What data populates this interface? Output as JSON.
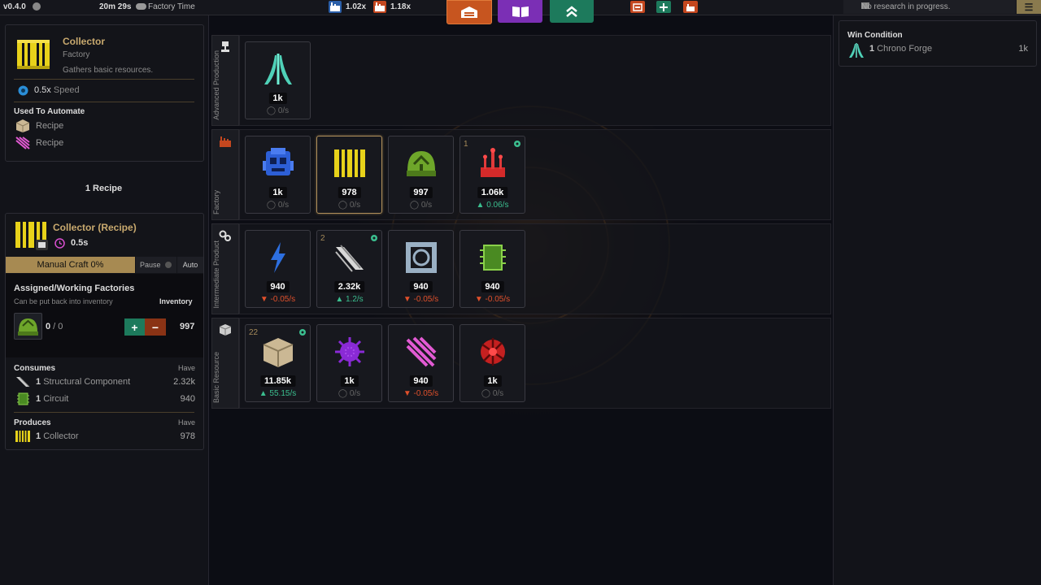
{
  "topbar": {
    "version": "v0.4.0",
    "elapsed": "20m 29s",
    "time_mode": "Factory Time",
    "multiplier_a": "1.02x",
    "multiplier_b": "1.18x",
    "research_status": "No research in progress.",
    "menu_glyph": "☰"
  },
  "selected": {
    "name": "Collector",
    "type": "Factory",
    "description": "Gathers basic resources.",
    "speed_value": "0.5x",
    "speed_label": "Speed",
    "used_to_automate_label": "Used To Automate",
    "automate": [
      "Recipe",
      "Recipe"
    ]
  },
  "recipes_count": "1 Recipe",
  "recipe": {
    "title": "Collector (Recipe)",
    "time": "0.5s",
    "manual_craft": "Manual Craft 0%",
    "pause_label": "Pause",
    "auto_label": "Auto",
    "assigned_title": "Assigned/Working Factories",
    "assigned_hint": "Can be put back into inventory",
    "inventory_label": "Inventory",
    "working": "0",
    "assigned_total": "0",
    "inventory_value": "997",
    "plus": "+",
    "minus": "−",
    "consumes_label": "Consumes",
    "have_label": "Have",
    "consumes": [
      {
        "qty": "1",
        "name": "Structural Component",
        "have": "2.32k"
      },
      {
        "qty": "1",
        "name": "Circuit",
        "have": "940"
      }
    ],
    "produces_label": "Produces",
    "produces": [
      {
        "qty": "1",
        "name": "Collector",
        "have": "978"
      }
    ]
  },
  "categories": [
    {
      "label": "Advanced Production"
    },
    {
      "label": "Factory"
    },
    {
      "label": "Intermediate Product"
    },
    {
      "label": "Basic Resource"
    }
  ],
  "items": {
    "advanced": [
      {
        "icon": "chrono-forge-icon",
        "count": "1k",
        "rate": "◯ 0/s",
        "badge": ""
      }
    ],
    "factory": [
      {
        "icon": "robot-factory-icon",
        "count": "1k",
        "rate": "◯ 0/s",
        "badge": ""
      },
      {
        "icon": "collector-icon",
        "count": "978",
        "rate": "◯ 0/s",
        "badge": ""
      },
      {
        "icon": "green-dome-icon",
        "count": "997",
        "rate": "◯ 0/s",
        "badge": ""
      },
      {
        "icon": "red-tower-icon",
        "count": "1.06k",
        "rate": "▲ 0.06/s",
        "badge": "1"
      }
    ],
    "intermediate": [
      {
        "icon": "lightning-icon",
        "count": "940",
        "rate": "▼ -0.05/s",
        "badge": ""
      },
      {
        "icon": "beam-icon",
        "count": "2.32k",
        "rate": "▲ 1.2/s",
        "badge": "2"
      },
      {
        "icon": "frame-icon",
        "count": "940",
        "rate": "▼ -0.05/s",
        "badge": ""
      },
      {
        "icon": "circuit-icon",
        "count": "940",
        "rate": "▼ -0.05/s",
        "badge": ""
      }
    ],
    "basic": [
      {
        "icon": "crate-icon",
        "count": "11.85k",
        "rate": "▲ 55.15/s",
        "badge": "22"
      },
      {
        "icon": "purple-flower-icon",
        "count": "1k",
        "rate": "◯ 0/s",
        "badge": ""
      },
      {
        "icon": "pink-crystal-icon",
        "count": "940",
        "rate": "▼ -0.05/s",
        "badge": ""
      },
      {
        "icon": "red-orb-icon",
        "count": "1k",
        "rate": "◯ 0/s",
        "badge": ""
      }
    ]
  },
  "win": {
    "label": "Win Condition",
    "qty": "1",
    "name": "Chrono Forge",
    "value": "1k"
  },
  "colors": {
    "accent_gold": "#c8a96e",
    "collector_yellow": "#e8d21a",
    "up_green": "#3bbf8f",
    "down_red": "#e0502b"
  }
}
